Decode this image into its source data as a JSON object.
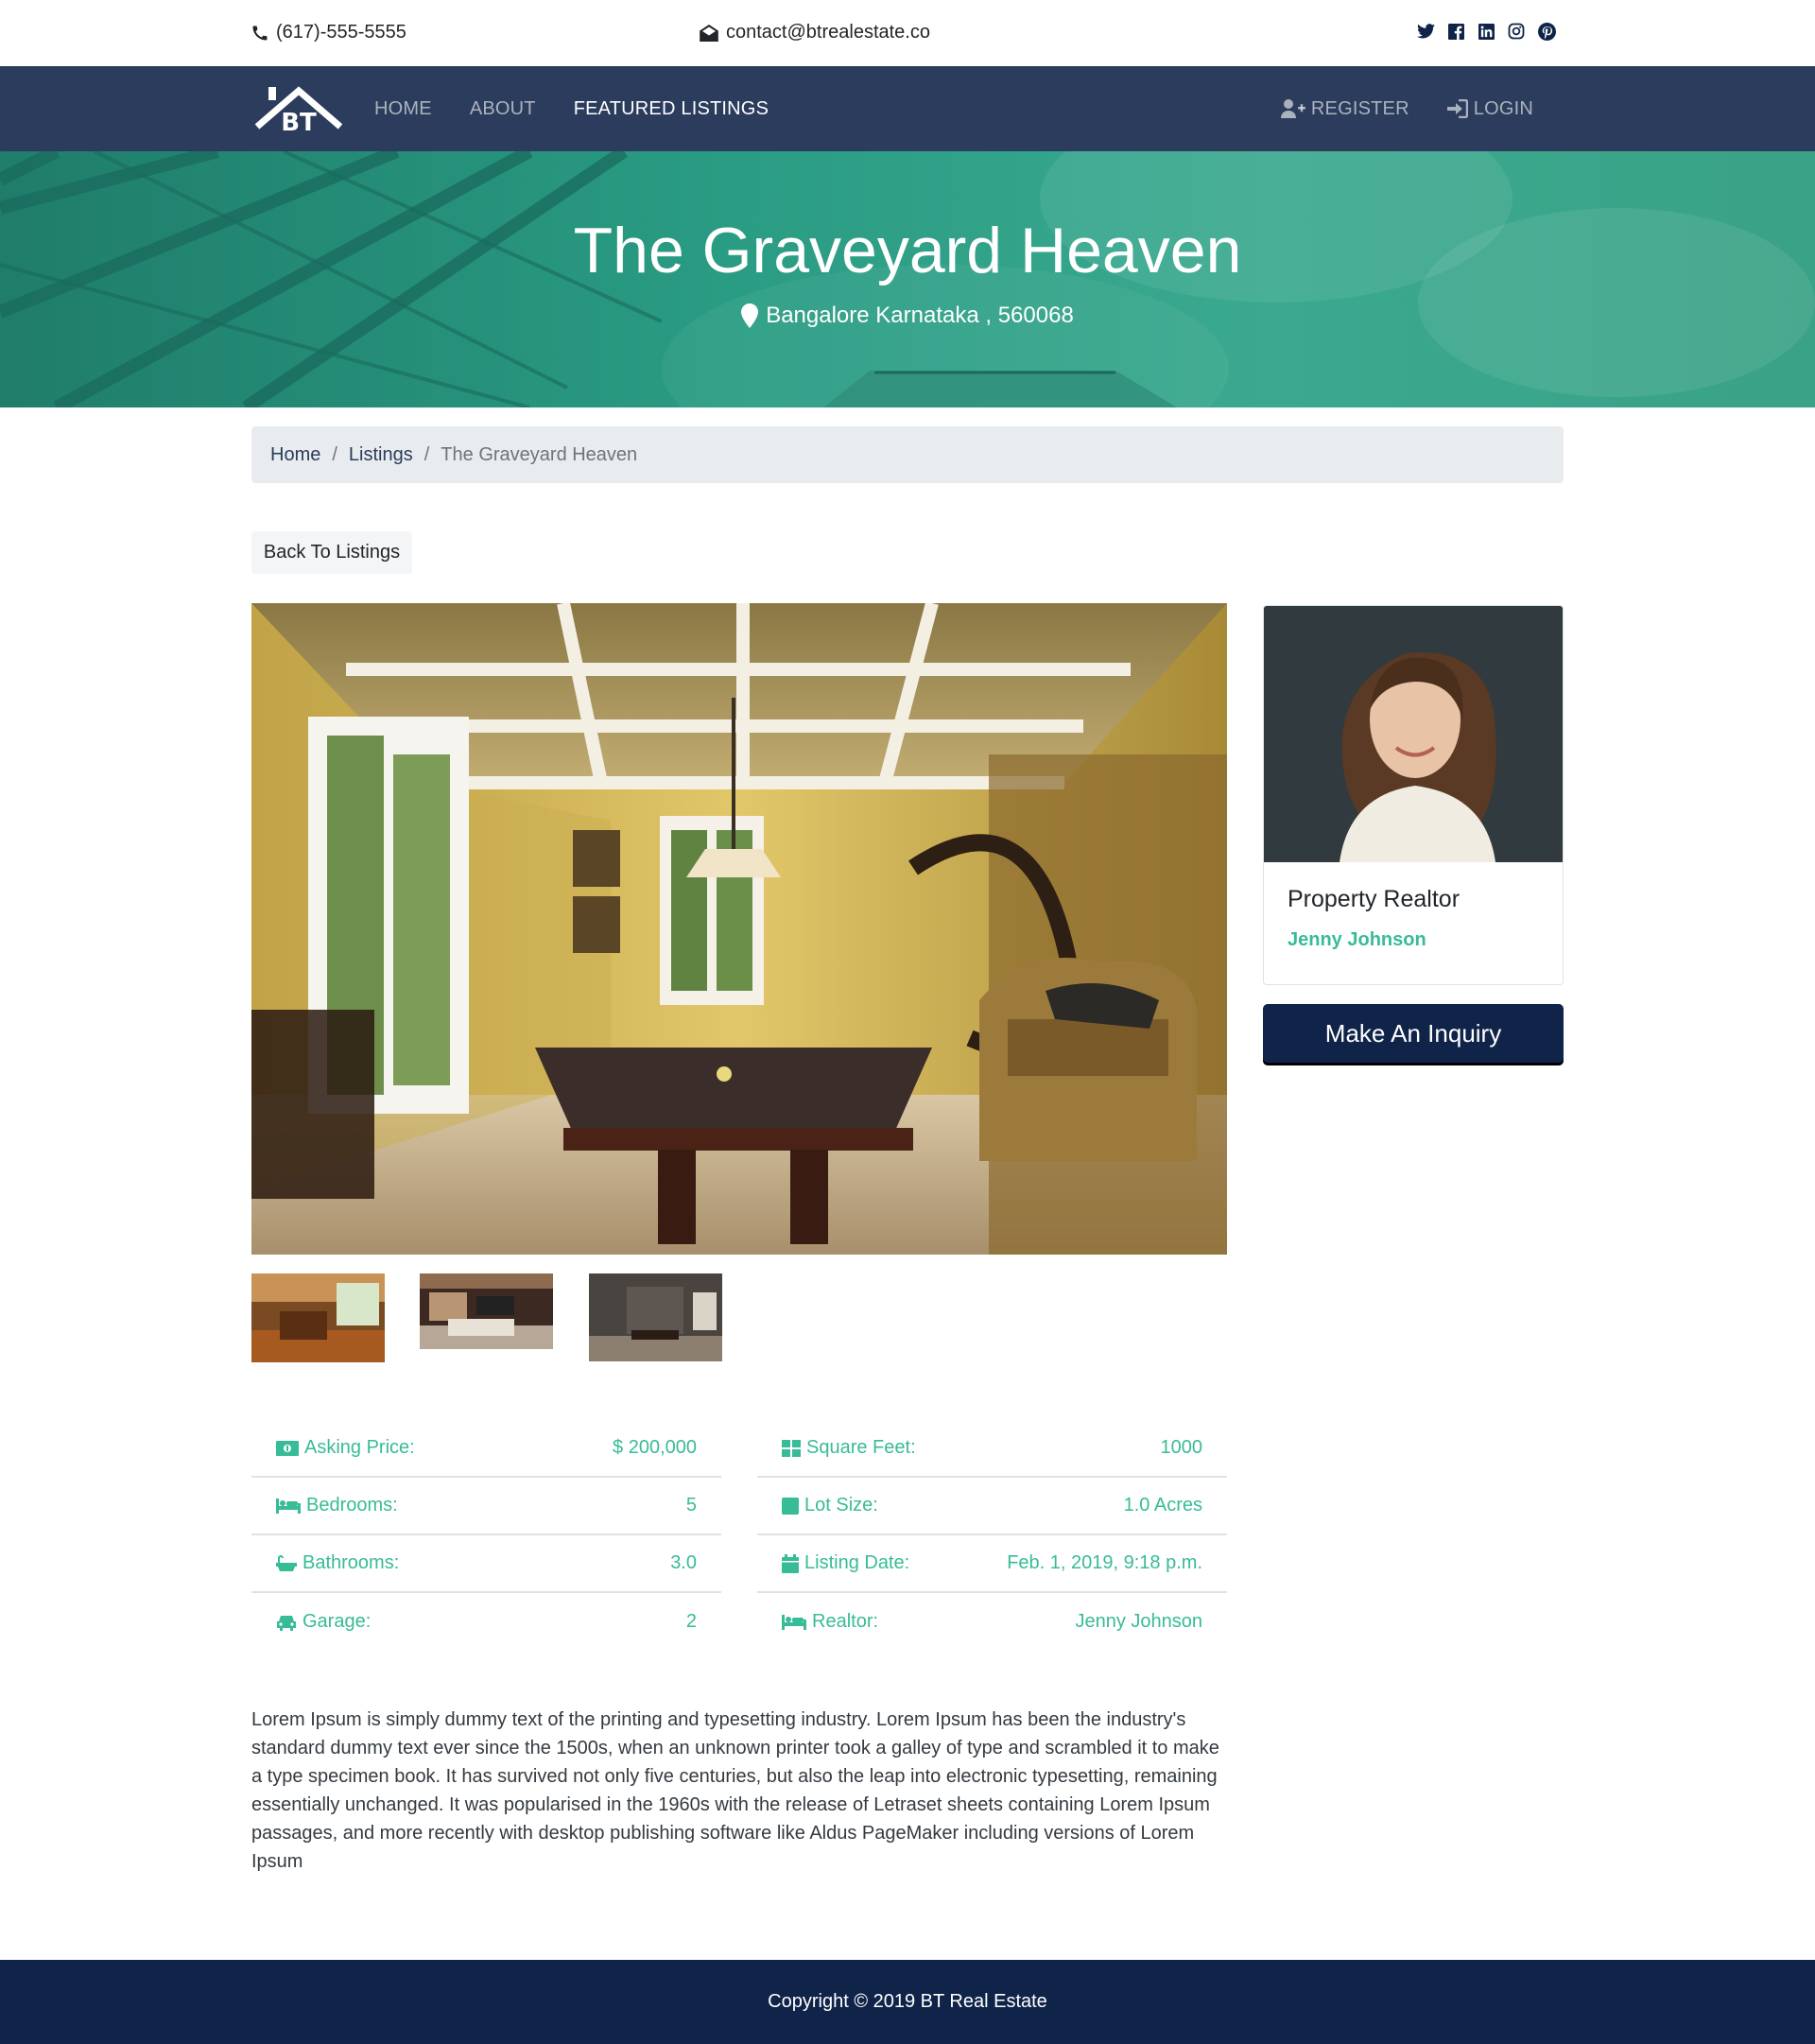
{
  "topbar": {
    "phone": "(617)-555-5555",
    "email": "contact@btrealestate.co",
    "socials": [
      "twitter-icon",
      "facebook-icon",
      "linkedin-icon",
      "instagram-icon",
      "pinterest-icon"
    ]
  },
  "navbar": {
    "logo_text": "BT",
    "links": [
      "HOME",
      "ABOUT",
      "FEATURED LISTINGS"
    ],
    "active_link": "FEATURED LISTINGS",
    "register": "REGISTER",
    "login": "LOGIN",
    "background": "#2b3c5c"
  },
  "hero": {
    "title": "The Graveyard Heaven",
    "location": "Bangalore Karnataka , 560068"
  },
  "breadcrumb": {
    "home": "Home",
    "listings": "Listings",
    "current": "The Graveyard Heaven"
  },
  "back_button": "Back To Listings",
  "realtor": {
    "title": "Property Realtor",
    "name": "Jenny Johnson"
  },
  "inquiry_button": "Make An Inquiry",
  "details_left": [
    {
      "icon": "money-icon",
      "label": "Asking Price:",
      "value": "$ 200,000"
    },
    {
      "icon": "bed-icon",
      "label": "Bedrooms:",
      "value": "5"
    },
    {
      "icon": "bath-icon",
      "label": "Bathrooms:",
      "value": "3.0"
    },
    {
      "icon": "car-icon",
      "label": "Garage:",
      "value": "2"
    }
  ],
  "details_right": [
    {
      "icon": "th-large-icon",
      "label": "Square Feet:",
      "value": "1000"
    },
    {
      "icon": "square-icon",
      "label": "Lot Size:",
      "value": "1.0 Acres"
    },
    {
      "icon": "calendar-icon",
      "label": "Listing Date:",
      "value": "Feb. 1, 2019, 9:18 p.m."
    },
    {
      "icon": "bed-icon",
      "label": "Realtor:",
      "value": "Jenny Johnson"
    }
  ],
  "description": "Lorem Ipsum is simply dummy text of the printing and typesetting industry. Lorem Ipsum has been the industry's standard dummy text ever since the 1500s, when an unknown printer took a galley of type and scrambled it to make a type specimen book. It has survived not only five centuries, but also the leap into electronic typesetting, remaining essentially unchanged. It was popularised in the 1960s with the release of Letraset sheets containing Lorem Ipsum passages, and more recently with desktop publishing software like Aldus PageMaker including versions of Lorem Ipsum",
  "footer": "Copyright © 2019 BT Real Estate",
  "colors": {
    "accent": "#38bb97",
    "dark_navy": "#10244a",
    "navbar": "#2b3c5c"
  }
}
